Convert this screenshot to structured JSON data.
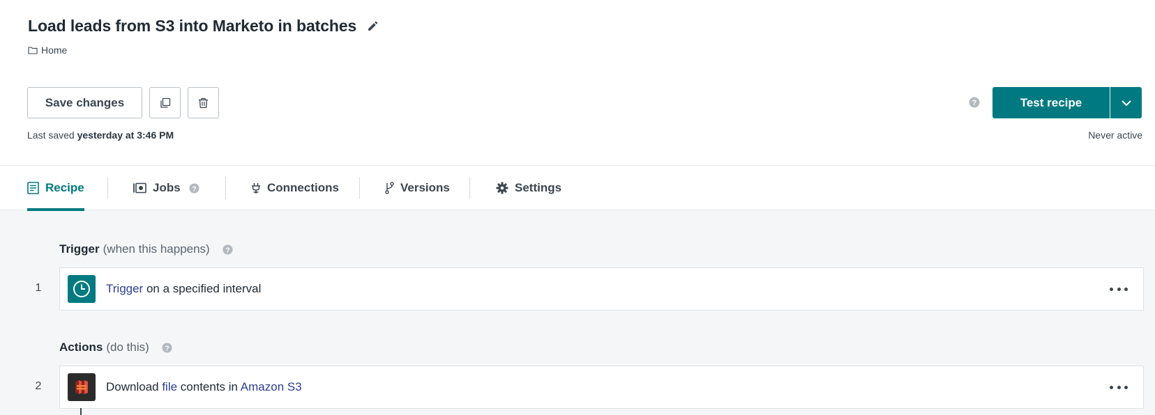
{
  "header": {
    "title": "Load leads from S3 into Marketo in batches",
    "folder": "Home",
    "save_label": "Save changes",
    "last_saved_prefix": "Last saved",
    "last_saved_time": "yesterday at 3:46 PM",
    "test_label": "Test recipe",
    "status": "Never active"
  },
  "tabs": [
    {
      "label": "Recipe",
      "active": true
    },
    {
      "label": "Jobs"
    },
    {
      "label": "Connections"
    },
    {
      "label": "Versions"
    },
    {
      "label": "Settings"
    }
  ],
  "trigger_section": {
    "label": "Trigger",
    "hint": "(when this happens)"
  },
  "actions_section": {
    "label": "Actions",
    "hint": "(do this)"
  },
  "steps": [
    {
      "number": "1",
      "link1": "Trigger",
      "text1": " on a specified interval",
      "icon": "clock-icon"
    },
    {
      "number": "2",
      "text0": "Download ",
      "link1": "file",
      "text1": " contents in ",
      "link2": "Amazon S3",
      "icon": "amazon-s3-icon"
    }
  ],
  "colors": {
    "accent": "#007a80",
    "link": "#2e3d94",
    "s3_icon_bg": "#2b2b2b",
    "s3_icon_fg": "#d9382e"
  }
}
